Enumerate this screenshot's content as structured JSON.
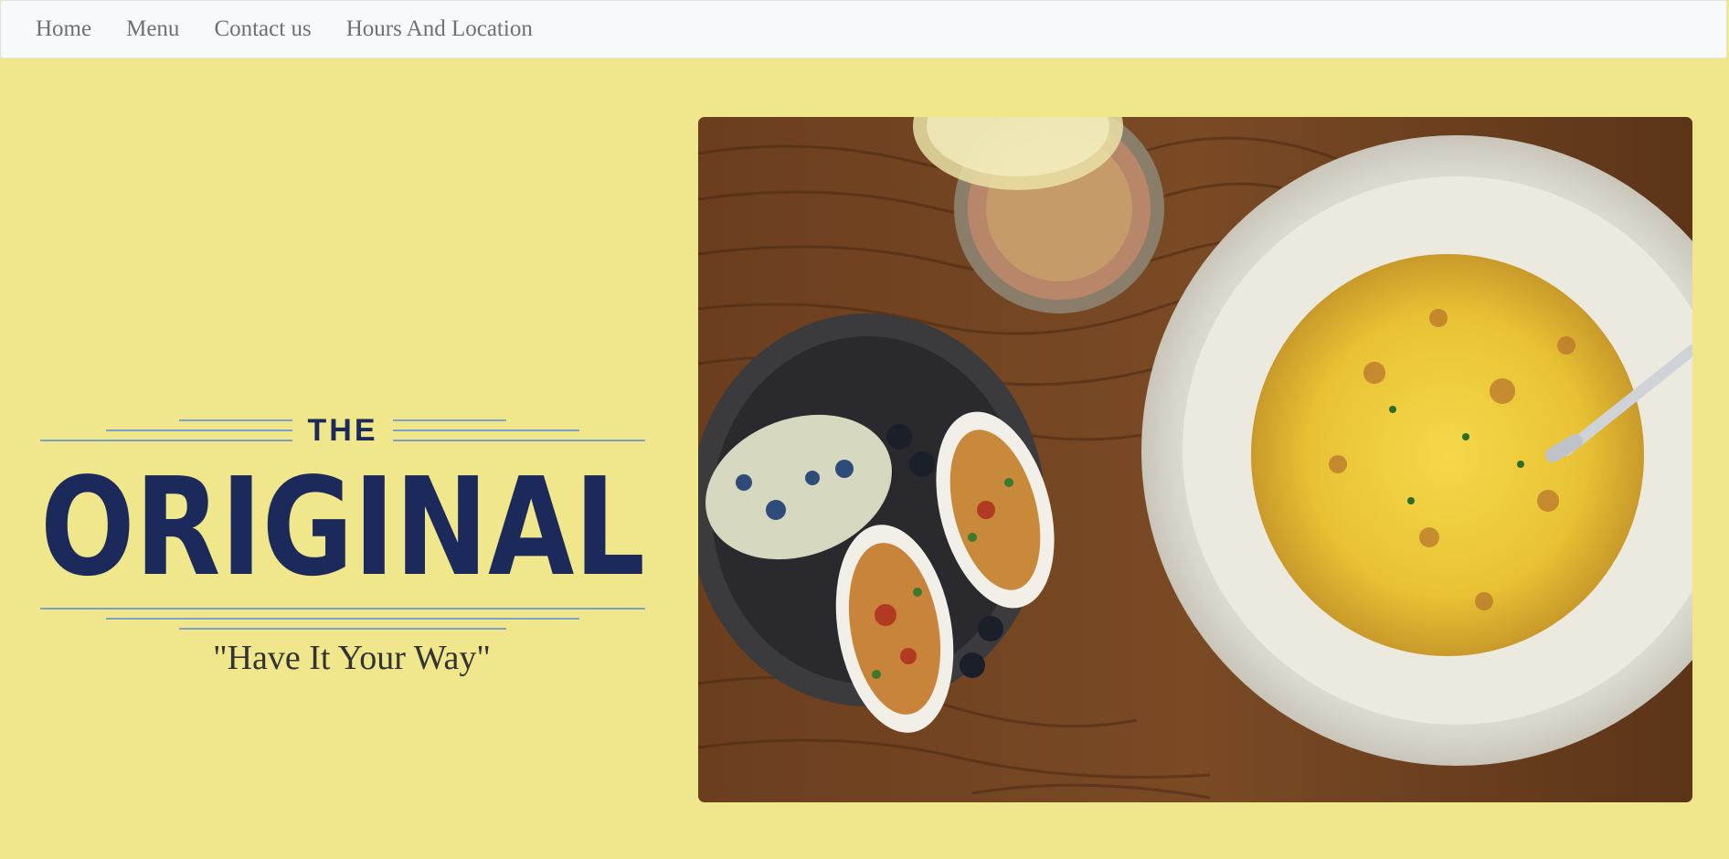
{
  "nav": {
    "items": [
      {
        "label": "Home"
      },
      {
        "label": "Menu"
      },
      {
        "label": "Contact us"
      },
      {
        "label": "Hours And Location"
      }
    ]
  },
  "brand": {
    "line1": "THE",
    "line2": "ORIGINAL",
    "color": "#1b2a5a",
    "rule_color": "#7ea3c4"
  },
  "tagline": "\"Have It Your Way\"",
  "hero": {
    "description_icon": "food-photo-icon"
  },
  "colors": {
    "background": "#f0e68c",
    "navbar": "#f8f9fa",
    "nav_text": "#707070"
  }
}
